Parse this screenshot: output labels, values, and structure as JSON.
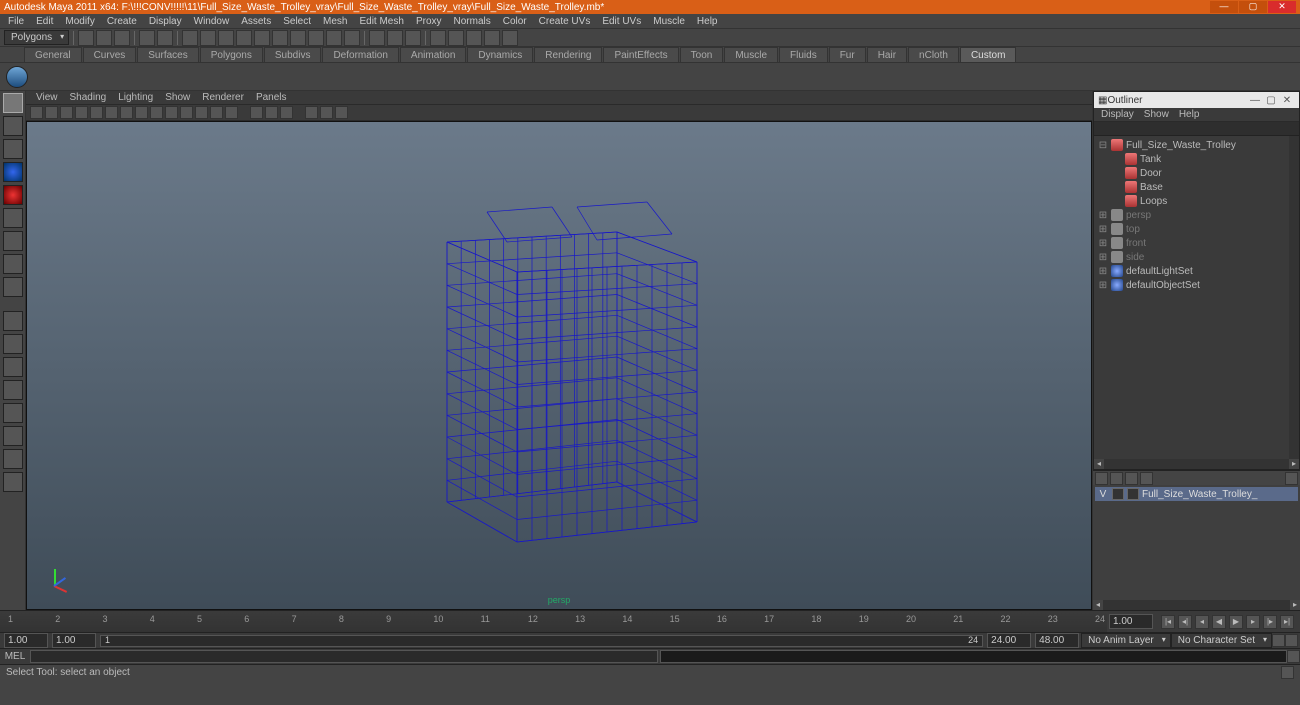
{
  "title": "Autodesk Maya 2011 x64: F:\\!!!CONV!!!!!\\11\\Full_Size_Waste_Trolley_vray\\Full_Size_Waste_Trolley_vray\\Full_Size_Waste_Trolley.mb*",
  "menubar": [
    "File",
    "Edit",
    "Modify",
    "Create",
    "Display",
    "Window",
    "Assets",
    "Select",
    "Mesh",
    "Edit Mesh",
    "Proxy",
    "Normals",
    "Color",
    "Create UVs",
    "Edit UVs",
    "Muscle",
    "Help"
  ],
  "mode_dropdown": "Polygons",
  "shelf_tabs": [
    "General",
    "Curves",
    "Surfaces",
    "Polygons",
    "Subdivs",
    "Deformation",
    "Animation",
    "Dynamics",
    "Rendering",
    "PaintEffects",
    "Toon",
    "Muscle",
    "Fluids",
    "Fur",
    "Hair",
    "nCloth",
    "Custom"
  ],
  "shelf_active": "Custom",
  "viewport_menu": [
    "View",
    "Shading",
    "Lighting",
    "Show",
    "Renderer",
    "Panels"
  ],
  "camera_label": "persp",
  "outliner": {
    "title": "Outliner",
    "menu": [
      "Display",
      "Show",
      "Help"
    ],
    "items": [
      {
        "label": "Full_Size_Waste_Trolley",
        "type": "grp",
        "indent": 0,
        "expanded": true
      },
      {
        "label": "Tank",
        "type": "grp",
        "indent": 1
      },
      {
        "label": "Door",
        "type": "grp",
        "indent": 1
      },
      {
        "label": "Base",
        "type": "grp",
        "indent": 1
      },
      {
        "label": "Loops",
        "type": "grp",
        "indent": 1
      }
    ],
    "cams": [
      {
        "label": "persp"
      },
      {
        "label": "top"
      },
      {
        "label": "front"
      },
      {
        "label": "side"
      }
    ],
    "sets": [
      {
        "label": "defaultLightSet"
      },
      {
        "label": "defaultObjectSet"
      }
    ]
  },
  "layer": {
    "name": "Full_Size_Waste_Trolley_",
    "vis": "V"
  },
  "timeline": {
    "ticks": [
      "1",
      "2",
      "3",
      "4",
      "5",
      "6",
      "7",
      "8",
      "9",
      "10",
      "11",
      "12",
      "13",
      "14",
      "15",
      "16",
      "17",
      "18",
      "19",
      "20",
      "21",
      "22",
      "23",
      "24"
    ],
    "range_start": "1.00",
    "range_end": "1.00",
    "inner_start": "1",
    "inner_end": "24",
    "end1": "24.00",
    "end2": "48.00",
    "anim_layer": "No Anim Layer",
    "char_set": "No Character Set",
    "cur": "1.00"
  },
  "cmd_label": "MEL",
  "status": "Select Tool: select an object"
}
